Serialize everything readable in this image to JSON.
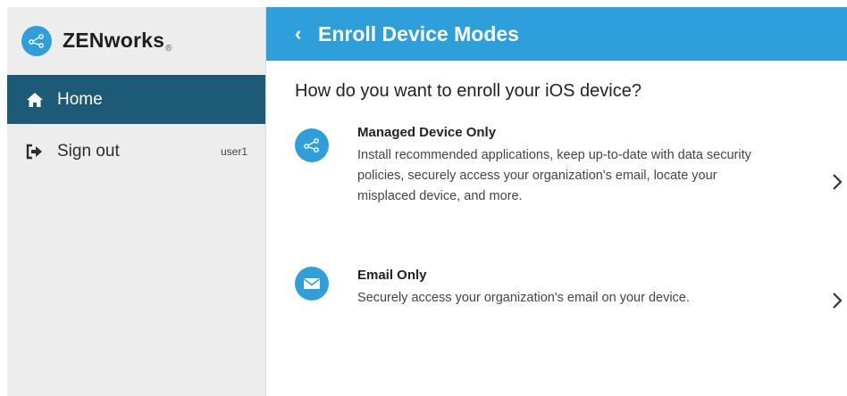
{
  "sidebar": {
    "brand": {
      "name": "ZENworks",
      "registered_mark": "®"
    },
    "items": [
      {
        "label": "Home",
        "icon": "home-icon",
        "active": true
      },
      {
        "label": "Sign out",
        "icon": "sign-out-icon",
        "active": false,
        "user": "user1"
      }
    ]
  },
  "header": {
    "back_glyph": "‹",
    "title": "Enroll Device Modes"
  },
  "main": {
    "question": "How do you want to enroll your iOS device?",
    "options": [
      {
        "title": "Managed Device Only",
        "description": "Install recommended applications, keep up-to-date with data security policies, securely access your organization's email, locate your misplaced device, and more.",
        "icon": "share-icon"
      },
      {
        "title": "Email Only",
        "description": "Securely access your organization's email on your device.",
        "icon": "envelope-icon"
      }
    ]
  },
  "colors": {
    "accent": "#2f9fdc",
    "sidebar_active": "#1d5a78",
    "sidebar_bg": "#ededed"
  }
}
